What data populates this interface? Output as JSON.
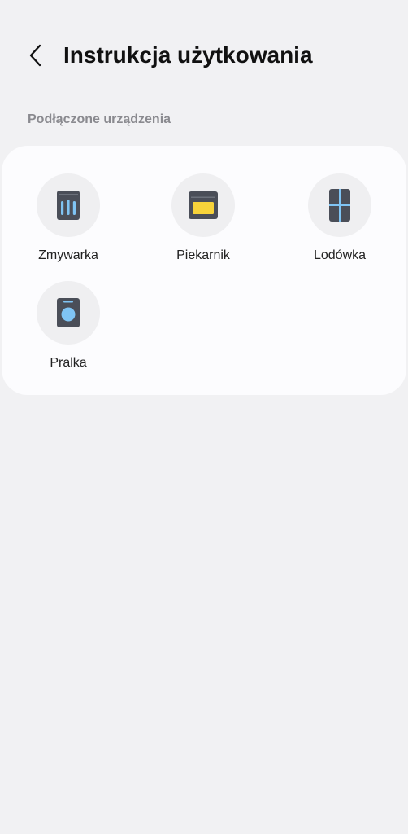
{
  "header": {
    "back_icon": "chevron-left-icon",
    "title": "Instrukcja użytkowania"
  },
  "section": {
    "label": "Podłączone urządzenia"
  },
  "devices": [
    {
      "label": "Zmywarka",
      "icon": "dishwasher-icon"
    },
    {
      "label": "Piekarnik",
      "icon": "oven-icon"
    },
    {
      "label": "Lodówka",
      "icon": "fridge-icon"
    },
    {
      "label": "Pralka",
      "icon": "washer-icon"
    }
  ],
  "colors": {
    "background": "#f1f1f3",
    "card": "#fcfcfe",
    "icon_circle": "#efeff1",
    "appliance_body": "#4a4e58",
    "accent_blue": "#7fc4f4",
    "accent_yellow": "#f7d33a"
  }
}
